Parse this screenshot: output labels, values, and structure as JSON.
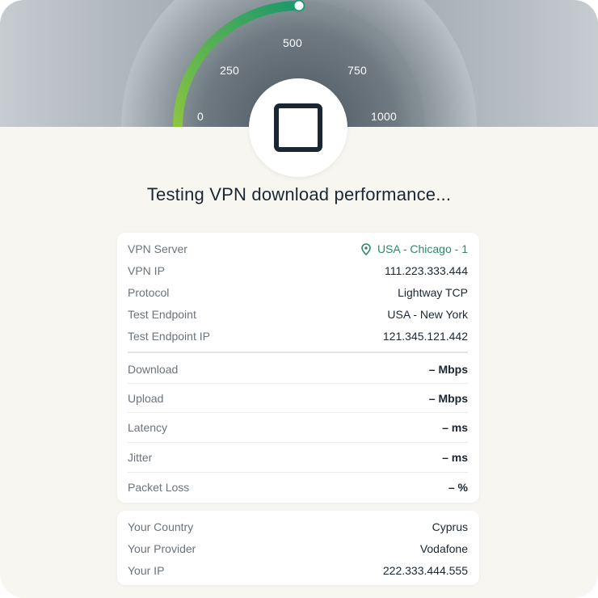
{
  "gauge": {
    "min": 0,
    "max": 1000,
    "ticks": [
      "0",
      "250",
      "500",
      "750",
      "1000"
    ],
    "current_value": 500,
    "colors": {
      "arc_start": "#8bc540",
      "arc_end": "#1f9a6a",
      "track": "#7f8a92"
    }
  },
  "stop_button": {
    "icon": "stop-icon"
  },
  "headline": "Testing VPN download performance...",
  "vpn_info": [
    {
      "label": "VPN Server",
      "value": "USA - Chicago - 1",
      "icon": "location-pin-icon"
    },
    {
      "label": "VPN IP",
      "value": "111.223.333.444"
    },
    {
      "label": "Protocol",
      "value": "Lightway TCP"
    },
    {
      "label": "Test Endpoint",
      "value": "USA - New York"
    },
    {
      "label": "Test Endpoint IP",
      "value": "121.345.121.442"
    }
  ],
  "metrics": [
    {
      "label": "Download",
      "value": "– Mbps"
    },
    {
      "label": "Upload",
      "value": "– Mbps"
    },
    {
      "label": "Latency",
      "value": "– ms"
    },
    {
      "label": "Jitter",
      "value": "– ms"
    },
    {
      "label": "Packet Loss",
      "value": "– %"
    }
  ],
  "client_info": [
    {
      "label": "Your Country",
      "value": "Cyprus"
    },
    {
      "label": "Your Provider",
      "value": "Vodafone"
    },
    {
      "label": "Your IP",
      "value": "222.333.444.555"
    }
  ],
  "colors": {
    "accent_green": "#2b8a63",
    "text_dark": "#1a2733",
    "text_muted": "#6b737b"
  }
}
